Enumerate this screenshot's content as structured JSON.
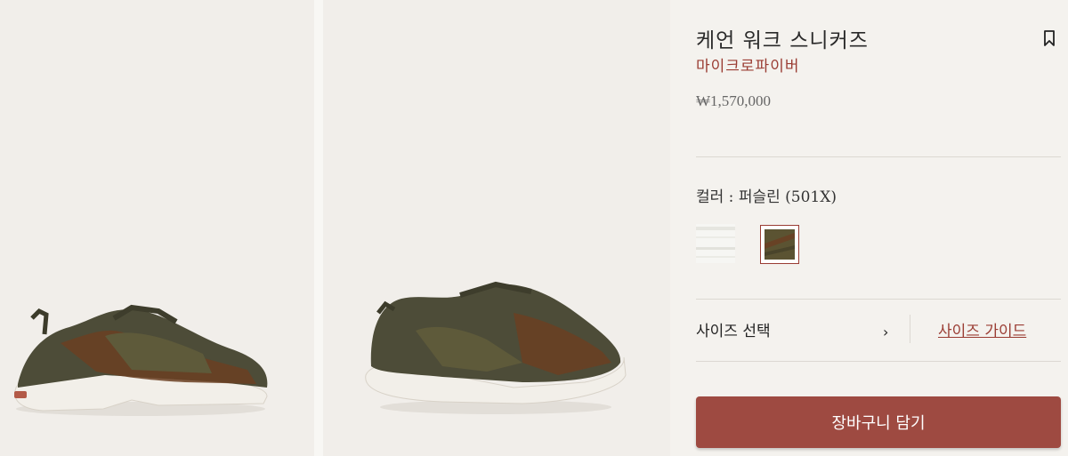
{
  "product": {
    "title": "케언 워크 스니커즈",
    "material": "마이크로파이버",
    "price": "₩1,570,000"
  },
  "color": {
    "label": "컬러 : 퍼슬린 (501X)",
    "swatches": [
      {
        "name": "white",
        "selected": false
      },
      {
        "name": "퍼슬린 (501X)",
        "selected": true
      }
    ]
  },
  "size": {
    "select_label": "사이즈 선택",
    "chevron": "›",
    "guide_label": "사이즈 가이드"
  },
  "cart": {
    "button_label": "장바구니 담기"
  },
  "icons": {
    "bookmark": "bookmark-icon"
  },
  "colors": {
    "accent": "#9e4a41",
    "accent_text": "#9a3c33",
    "shoe_dark": "#4a4a36",
    "shoe_brown": "#6b3f22"
  }
}
